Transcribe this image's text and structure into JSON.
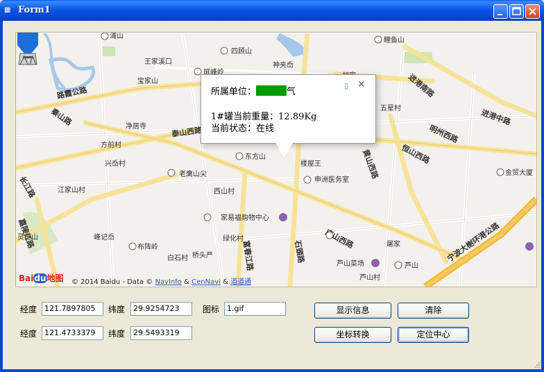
{
  "window": {
    "title": "Form1",
    "app_icon": "form-icon"
  },
  "title_buttons": {
    "minimize": "minimize-icon",
    "maximize": "maximize-icon",
    "close": "close-icon"
  },
  "map": {
    "popup": {
      "unit_label": "所属单位：",
      "unit_suffix": "气",
      "weight_line": "1#罐当前重量：12.89Kg",
      "status_line": "当前状态：在线",
      "phone_icon": "phone-icon",
      "close_icon": "close-icon"
    },
    "labels": [
      "浦山",
      "鲤鱼山",
      "王家溪口",
      "四顾山",
      "屏峰岭",
      "神夹岙",
      "宝家山",
      "胡家",
      "进港南路",
      "路霞公路",
      "五星村",
      "秦山路",
      "净居寺",
      "泰山西路",
      "明州西路",
      "进港中路",
      "方前村",
      "兴岙村",
      "东方山",
      "恒山西路",
      "老鹰山尖",
      "金贸大厦",
      "江家山村",
      "西山村",
      "申洲医务室",
      "楼屋王",
      "黄山西路",
      "家易福购物中心",
      "峰记岙",
      "绿化村",
      "庐山西路",
      "屠家",
      "灵芝山",
      "布阵岭",
      "桥头严",
      "芦山菜场",
      "芦山",
      "石頭路",
      "宁波大榭环港公路",
      "白石村",
      "芦山村",
      "黄山西路",
      "富春江路",
      "嘉陵江路",
      "长江路"
    ],
    "copyright": {
      "prefix": "© 2014 Baidu - Data ©",
      "navinfo": "NavInfo",
      "amp": "&",
      "cennavi": "CenNavi",
      "amp2": "&",
      "daodao": "道道通"
    },
    "logo": {
      "bai": "Bai",
      "du": "du",
      "ditu": "地图"
    }
  },
  "form": {
    "row1": {
      "lon_label": "经度",
      "lon_value": "121.7897805",
      "lat_label": "纬度",
      "lat_value": "29.9254723",
      "icon_label": "图标",
      "icon_value": "1.gif"
    },
    "row2": {
      "lon_label": "经度",
      "lon_value": "121.4733379",
      "lat_label": "纬度",
      "lat_value": "29.5493319"
    },
    "buttons": {
      "show_info": "显示信息",
      "clear": "清除",
      "convert": "坐标转换",
      "center": "定位中心"
    }
  }
}
